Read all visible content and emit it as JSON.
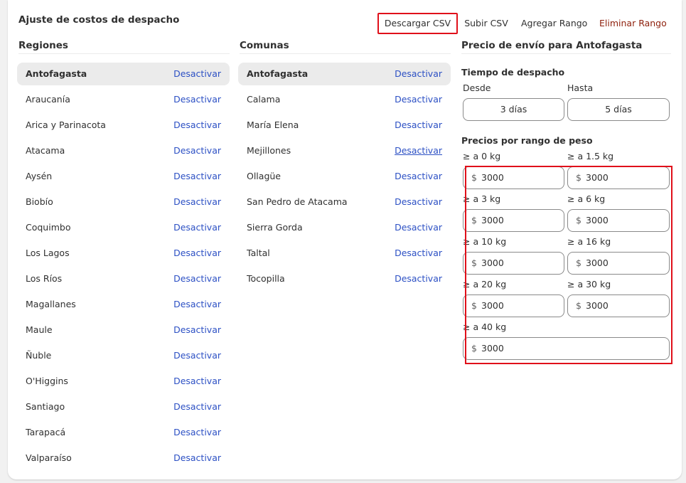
{
  "page_title": "Ajuste de costos de despacho",
  "toolbar": {
    "download_csv": "Descargar CSV",
    "upload_csv": "Subir CSV",
    "add_range": "Agregar Rango",
    "delete_range": "Eliminar Rango"
  },
  "regions": {
    "heading": "Regiones",
    "action_label": "Desactivar",
    "items": [
      "Antofagasta",
      "Araucanía",
      "Arica y Parinacota",
      "Atacama",
      "Aysén",
      "Biobío",
      "Coquimbo",
      "Los Lagos",
      "Los Ríos",
      "Magallanes",
      "Maule",
      "Ñuble",
      "O'Higgins",
      "Santiago",
      "Tarapacá",
      "Valparaíso"
    ],
    "selected": "Antofagasta"
  },
  "communes": {
    "heading": "Comunas",
    "action_label": "Desactivar",
    "items": [
      "Antofagasta",
      "Calama",
      "María Elena",
      "Mejillones",
      "Ollagüe",
      "San Pedro de Atacama",
      "Sierra Gorda",
      "Taltal",
      "Tocopilla"
    ],
    "selected": "Antofagasta"
  },
  "shipping": {
    "heading": "Precio de envío para Antofagasta",
    "delivery_time": {
      "title": "Tiempo de despacho",
      "from_label": "Desde",
      "to_label": "Hasta",
      "from_value": "3 días",
      "to_value": "5 días"
    },
    "weight_prices": {
      "title": "Precios por rango de peso",
      "currency_symbol": "$",
      "ranges": [
        {
          "label": "≥ a 0 kg",
          "price": "3000"
        },
        {
          "label": "≥ a 1.5 kg",
          "price": "3000"
        },
        {
          "label": "≥ a 3 kg",
          "price": "3000"
        },
        {
          "label": "≥ a 6 kg",
          "price": "3000"
        },
        {
          "label": "≥ a 10 kg",
          "price": "3000"
        },
        {
          "label": "≥ a 16 kg",
          "price": "3000"
        },
        {
          "label": "≥ a 20 kg",
          "price": "3000"
        },
        {
          "label": "≥ a 30 kg",
          "price": "3000"
        },
        {
          "label": "≥ a 40 kg",
          "price": "3000"
        }
      ]
    }
  },
  "colors": {
    "link": "#2c50c4",
    "danger": "#8e1f0b",
    "highlight_border": "#e0101a",
    "selected_row": "#ebebeb"
  }
}
